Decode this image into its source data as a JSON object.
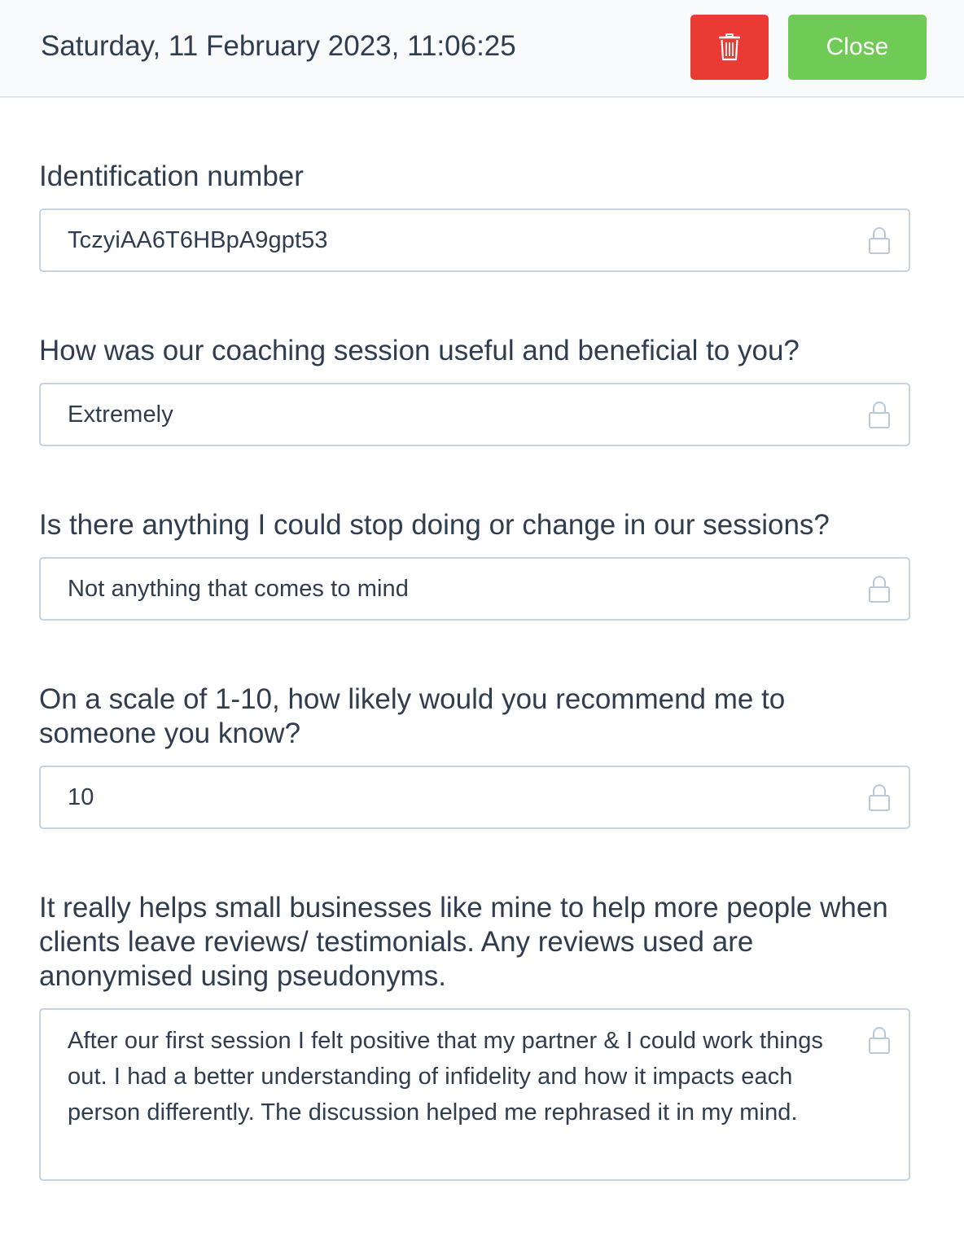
{
  "header": {
    "datetime": "Saturday, 11 February 2023, 11:06:25",
    "close_label": "Close",
    "delete_icon": "trash-icon",
    "delete_color": "#ea3a34",
    "close_color": "#6fcb56"
  },
  "fields": [
    {
      "label": "Identification number",
      "value": "TczyiAA6T6HBpA9gpt53",
      "icon": "lock-icon"
    },
    {
      "label": "How was our coaching session useful and beneficial to you?",
      "value": "Extremely",
      "icon": "lock-icon"
    },
    {
      "label": "Is there anything I could stop doing or change in our sessions?",
      "value": "Not anything that comes to mind",
      "icon": "lock-icon"
    },
    {
      "label": "On a scale of 1-10, how likely would you recommend me to someone you know?",
      "value": "10",
      "icon": "lock-icon"
    },
    {
      "label": "It really helps small businesses like mine to help more people when clients leave reviews/ testimonials. Any reviews used are anonymised using pseudonyms.",
      "value": "After our first session I felt positive that my partner & I could work things out. I had a better understanding of infidelity and how it impacts each person differently. The discussion helped me rephrased it in my mind.",
      "icon": "lock-icon"
    }
  ]
}
